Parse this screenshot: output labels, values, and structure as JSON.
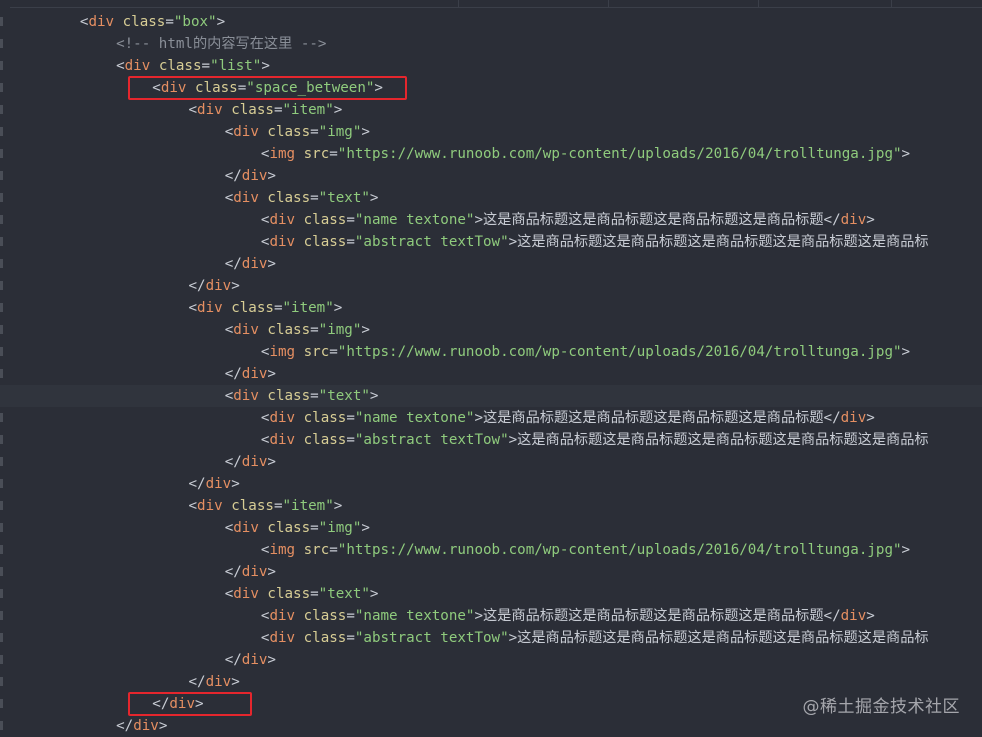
{
  "editor": {
    "watermark": "@稀土掘金技术社区",
    "colors": {
      "background": "#2b2e37",
      "tag": "#e58f62",
      "attribute": "#d7cd95",
      "string": "#8fcb7d",
      "comment": "#8a8f98",
      "highlight": "#e5262d"
    },
    "lines": [
      {
        "indent": 2,
        "tokens": [
          [
            "t",
            "<"
          ],
          [
            "tag",
            "div"
          ],
          [
            "t",
            " "
          ],
          [
            "attr",
            "class"
          ],
          [
            "t",
            "="
          ],
          [
            "str",
            "\"box\""
          ],
          [
            "t",
            ">"
          ]
        ]
      },
      {
        "indent": 3,
        "tokens": [
          [
            "comment",
            "<!-- html的内容写在这里 -->"
          ]
        ]
      },
      {
        "indent": 3,
        "tokens": [
          [
            "t",
            "<"
          ],
          [
            "tag",
            "div"
          ],
          [
            "t",
            " "
          ],
          [
            "attr",
            "class"
          ],
          [
            "t",
            "="
          ],
          [
            "str",
            "\"list\""
          ],
          [
            "t",
            ">"
          ]
        ]
      },
      {
        "indent": 4,
        "highlight": true,
        "tokens": [
          [
            "t",
            "<"
          ],
          [
            "tag",
            "div"
          ],
          [
            "t",
            " "
          ],
          [
            "attr",
            "class"
          ],
          [
            "t",
            "="
          ],
          [
            "str",
            "\"space_between\""
          ],
          [
            "t",
            ">"
          ]
        ]
      },
      {
        "indent": 5,
        "tokens": [
          [
            "t",
            "<"
          ],
          [
            "tag",
            "div"
          ],
          [
            "t",
            " "
          ],
          [
            "attr",
            "class"
          ],
          [
            "t",
            "="
          ],
          [
            "str",
            "\"item\""
          ],
          [
            "t",
            ">"
          ]
        ]
      },
      {
        "indent": 6,
        "tokens": [
          [
            "t",
            "<"
          ],
          [
            "tag",
            "div"
          ],
          [
            "t",
            " "
          ],
          [
            "attr",
            "class"
          ],
          [
            "t",
            "="
          ],
          [
            "str",
            "\"img\""
          ],
          [
            "t",
            ">"
          ]
        ]
      },
      {
        "indent": 7,
        "tokens": [
          [
            "t",
            "<"
          ],
          [
            "tag",
            "img"
          ],
          [
            "t",
            " "
          ],
          [
            "attr",
            "src"
          ],
          [
            "t",
            "="
          ],
          [
            "str",
            "\"https://www.runoob.com/wp-content/uploads/2016/04/trolltunga.jpg\""
          ],
          [
            "t",
            ">"
          ]
        ]
      },
      {
        "indent": 6,
        "tokens": [
          [
            "t",
            "</"
          ],
          [
            "tag",
            "div"
          ],
          [
            "t",
            ">"
          ]
        ]
      },
      {
        "indent": 6,
        "tokens": [
          [
            "t",
            "<"
          ],
          [
            "tag",
            "div"
          ],
          [
            "t",
            " "
          ],
          [
            "attr",
            "class"
          ],
          [
            "t",
            "="
          ],
          [
            "str",
            "\"text\""
          ],
          [
            "t",
            ">"
          ]
        ]
      },
      {
        "indent": 7,
        "tokens": [
          [
            "t",
            "<"
          ],
          [
            "tag",
            "div"
          ],
          [
            "t",
            " "
          ],
          [
            "attr",
            "class"
          ],
          [
            "t",
            "="
          ],
          [
            "str",
            "\"name textone\""
          ],
          [
            "t",
            ">"
          ],
          [
            "cjk",
            "这是商品标题这是商品标题这是商品标题这是商品标题"
          ],
          [
            "t",
            "</"
          ],
          [
            "tag",
            "div"
          ],
          [
            "t",
            ">"
          ]
        ]
      },
      {
        "indent": 7,
        "tokens": [
          [
            "t",
            "<"
          ],
          [
            "tag",
            "div"
          ],
          [
            "t",
            " "
          ],
          [
            "attr",
            "class"
          ],
          [
            "t",
            "="
          ],
          [
            "str",
            "\"abstract textTow\""
          ],
          [
            "t",
            ">"
          ],
          [
            "cjk",
            "这是商品标题这是商品标题这是商品标题这是商品标题这是商品标"
          ]
        ]
      },
      {
        "indent": 6,
        "tokens": [
          [
            "t",
            "</"
          ],
          [
            "tag",
            "div"
          ],
          [
            "t",
            ">"
          ]
        ]
      },
      {
        "indent": 5,
        "tokens": [
          [
            "t",
            "</"
          ],
          [
            "tag",
            "div"
          ],
          [
            "t",
            ">"
          ]
        ]
      },
      {
        "indent": 5,
        "tokens": [
          [
            "t",
            "<"
          ],
          [
            "tag",
            "div"
          ],
          [
            "t",
            " "
          ],
          [
            "attr",
            "class"
          ],
          [
            "t",
            "="
          ],
          [
            "str",
            "\"item\""
          ],
          [
            "t",
            ">"
          ]
        ]
      },
      {
        "indent": 6,
        "tokens": [
          [
            "t",
            "<"
          ],
          [
            "tag",
            "div"
          ],
          [
            "t",
            " "
          ],
          [
            "attr",
            "class"
          ],
          [
            "t",
            "="
          ],
          [
            "str",
            "\"img\""
          ],
          [
            "t",
            ">"
          ]
        ]
      },
      {
        "indent": 7,
        "tokens": [
          [
            "t",
            "<"
          ],
          [
            "tag",
            "img"
          ],
          [
            "t",
            " "
          ],
          [
            "attr",
            "src"
          ],
          [
            "t",
            "="
          ],
          [
            "str",
            "\"https://www.runoob.com/wp-content/uploads/2016/04/trolltunga.jpg\""
          ],
          [
            "t",
            ">"
          ]
        ]
      },
      {
        "indent": 6,
        "tokens": [
          [
            "t",
            "</"
          ],
          [
            "tag",
            "div"
          ],
          [
            "t",
            ">"
          ]
        ]
      },
      {
        "indent": 6,
        "current": true,
        "tokens": [
          [
            "t",
            "<"
          ],
          [
            "tag",
            "div"
          ],
          [
            "t",
            " "
          ],
          [
            "attr",
            "class"
          ],
          [
            "t",
            "="
          ],
          [
            "str",
            "\"text\""
          ],
          [
            "t",
            ">"
          ]
        ]
      },
      {
        "indent": 7,
        "tokens": [
          [
            "t",
            "<"
          ],
          [
            "tag",
            "div"
          ],
          [
            "t",
            " "
          ],
          [
            "attr",
            "class"
          ],
          [
            "t",
            "="
          ],
          [
            "str",
            "\"name textone\""
          ],
          [
            "t",
            ">"
          ],
          [
            "cjk",
            "这是商品标题这是商品标题这是商品标题这是商品标题"
          ],
          [
            "t",
            "</"
          ],
          [
            "tag",
            "div"
          ],
          [
            "t",
            ">"
          ]
        ]
      },
      {
        "indent": 7,
        "tokens": [
          [
            "t",
            "<"
          ],
          [
            "tag",
            "div"
          ],
          [
            "t",
            " "
          ],
          [
            "attr",
            "class"
          ],
          [
            "t",
            "="
          ],
          [
            "str",
            "\"abstract textTow\""
          ],
          [
            "t",
            ">"
          ],
          [
            "cjk",
            "这是商品标题这是商品标题这是商品标题这是商品标题这是商品标"
          ]
        ]
      },
      {
        "indent": 6,
        "tokens": [
          [
            "t",
            "</"
          ],
          [
            "tag",
            "div"
          ],
          [
            "t",
            ">"
          ]
        ]
      },
      {
        "indent": 5,
        "tokens": [
          [
            "t",
            "</"
          ],
          [
            "tag",
            "div"
          ],
          [
            "t",
            ">"
          ]
        ]
      },
      {
        "indent": 5,
        "tokens": [
          [
            "t",
            "<"
          ],
          [
            "tag",
            "div"
          ],
          [
            "t",
            " "
          ],
          [
            "attr",
            "class"
          ],
          [
            "t",
            "="
          ],
          [
            "str",
            "\"item\""
          ],
          [
            "t",
            ">"
          ]
        ]
      },
      {
        "indent": 6,
        "tokens": [
          [
            "t",
            "<"
          ],
          [
            "tag",
            "div"
          ],
          [
            "t",
            " "
          ],
          [
            "attr",
            "class"
          ],
          [
            "t",
            "="
          ],
          [
            "str",
            "\"img\""
          ],
          [
            "t",
            ">"
          ]
        ]
      },
      {
        "indent": 7,
        "tokens": [
          [
            "t",
            "<"
          ],
          [
            "tag",
            "img"
          ],
          [
            "t",
            " "
          ],
          [
            "attr",
            "src"
          ],
          [
            "t",
            "="
          ],
          [
            "str",
            "\"https://www.runoob.com/wp-content/uploads/2016/04/trolltunga.jpg\""
          ],
          [
            "t",
            ">"
          ]
        ]
      },
      {
        "indent": 6,
        "tokens": [
          [
            "t",
            "</"
          ],
          [
            "tag",
            "div"
          ],
          [
            "t",
            ">"
          ]
        ]
      },
      {
        "indent": 6,
        "tokens": [
          [
            "t",
            "<"
          ],
          [
            "tag",
            "div"
          ],
          [
            "t",
            " "
          ],
          [
            "attr",
            "class"
          ],
          [
            "t",
            "="
          ],
          [
            "str",
            "\"text\""
          ],
          [
            "t",
            ">"
          ]
        ]
      },
      {
        "indent": 7,
        "tokens": [
          [
            "t",
            "<"
          ],
          [
            "tag",
            "div"
          ],
          [
            "t",
            " "
          ],
          [
            "attr",
            "class"
          ],
          [
            "t",
            "="
          ],
          [
            "str",
            "\"name textone\""
          ],
          [
            "t",
            ">"
          ],
          [
            "cjk",
            "这是商品标题这是商品标题这是商品标题这是商品标题"
          ],
          [
            "t",
            "</"
          ],
          [
            "tag",
            "div"
          ],
          [
            "t",
            ">"
          ]
        ]
      },
      {
        "indent": 7,
        "tokens": [
          [
            "t",
            "<"
          ],
          [
            "tag",
            "div"
          ],
          [
            "t",
            " "
          ],
          [
            "attr",
            "class"
          ],
          [
            "t",
            "="
          ],
          [
            "str",
            "\"abstract textTow\""
          ],
          [
            "t",
            ">"
          ],
          [
            "cjk",
            "这是商品标题这是商品标题这是商品标题这是商品标题这是商品标"
          ]
        ]
      },
      {
        "indent": 6,
        "tokens": [
          [
            "t",
            "</"
          ],
          [
            "tag",
            "div"
          ],
          [
            "t",
            ">"
          ]
        ]
      },
      {
        "indent": 5,
        "tokens": [
          [
            "t",
            "</"
          ],
          [
            "tag",
            "div"
          ],
          [
            "t",
            ">"
          ]
        ]
      },
      {
        "indent": 4,
        "highlight": true,
        "tokens": [
          [
            "t",
            "</"
          ],
          [
            "tag",
            "div"
          ],
          [
            "t",
            ">"
          ]
        ]
      },
      {
        "indent": 3,
        "tokens": [
          [
            "t",
            "</"
          ],
          [
            "tag",
            "div"
          ],
          [
            "t",
            ">"
          ]
        ]
      }
    ]
  }
}
